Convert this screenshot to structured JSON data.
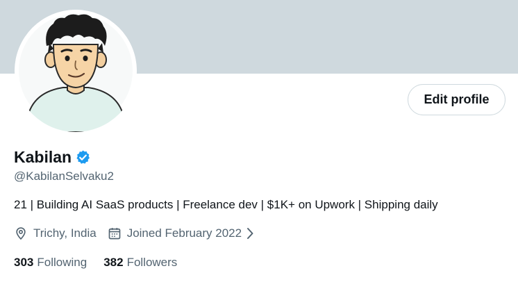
{
  "profile": {
    "name": "Kabilan",
    "handle": "@KabilanSelvaku2",
    "bio": "21 | Building AI SaaS products | Freelance dev | $1K+ on Upwork | Shipping daily",
    "location": "Trichy, India",
    "joined": "Joined February 2022",
    "verified": true
  },
  "actions": {
    "edit_profile_label": "Edit profile"
  },
  "stats": {
    "following_count": "303",
    "following_label": "Following",
    "followers_count": "382",
    "followers_label": "Followers"
  },
  "icons": {
    "verified": "verified-badge-icon",
    "location": "location-pin-icon",
    "joined": "calendar-icon",
    "more": "chevron-right-icon"
  },
  "colors": {
    "banner": "#cfd9de",
    "verified": "#1d9bf0",
    "text_primary": "#0f1419",
    "text_secondary": "#536471"
  }
}
